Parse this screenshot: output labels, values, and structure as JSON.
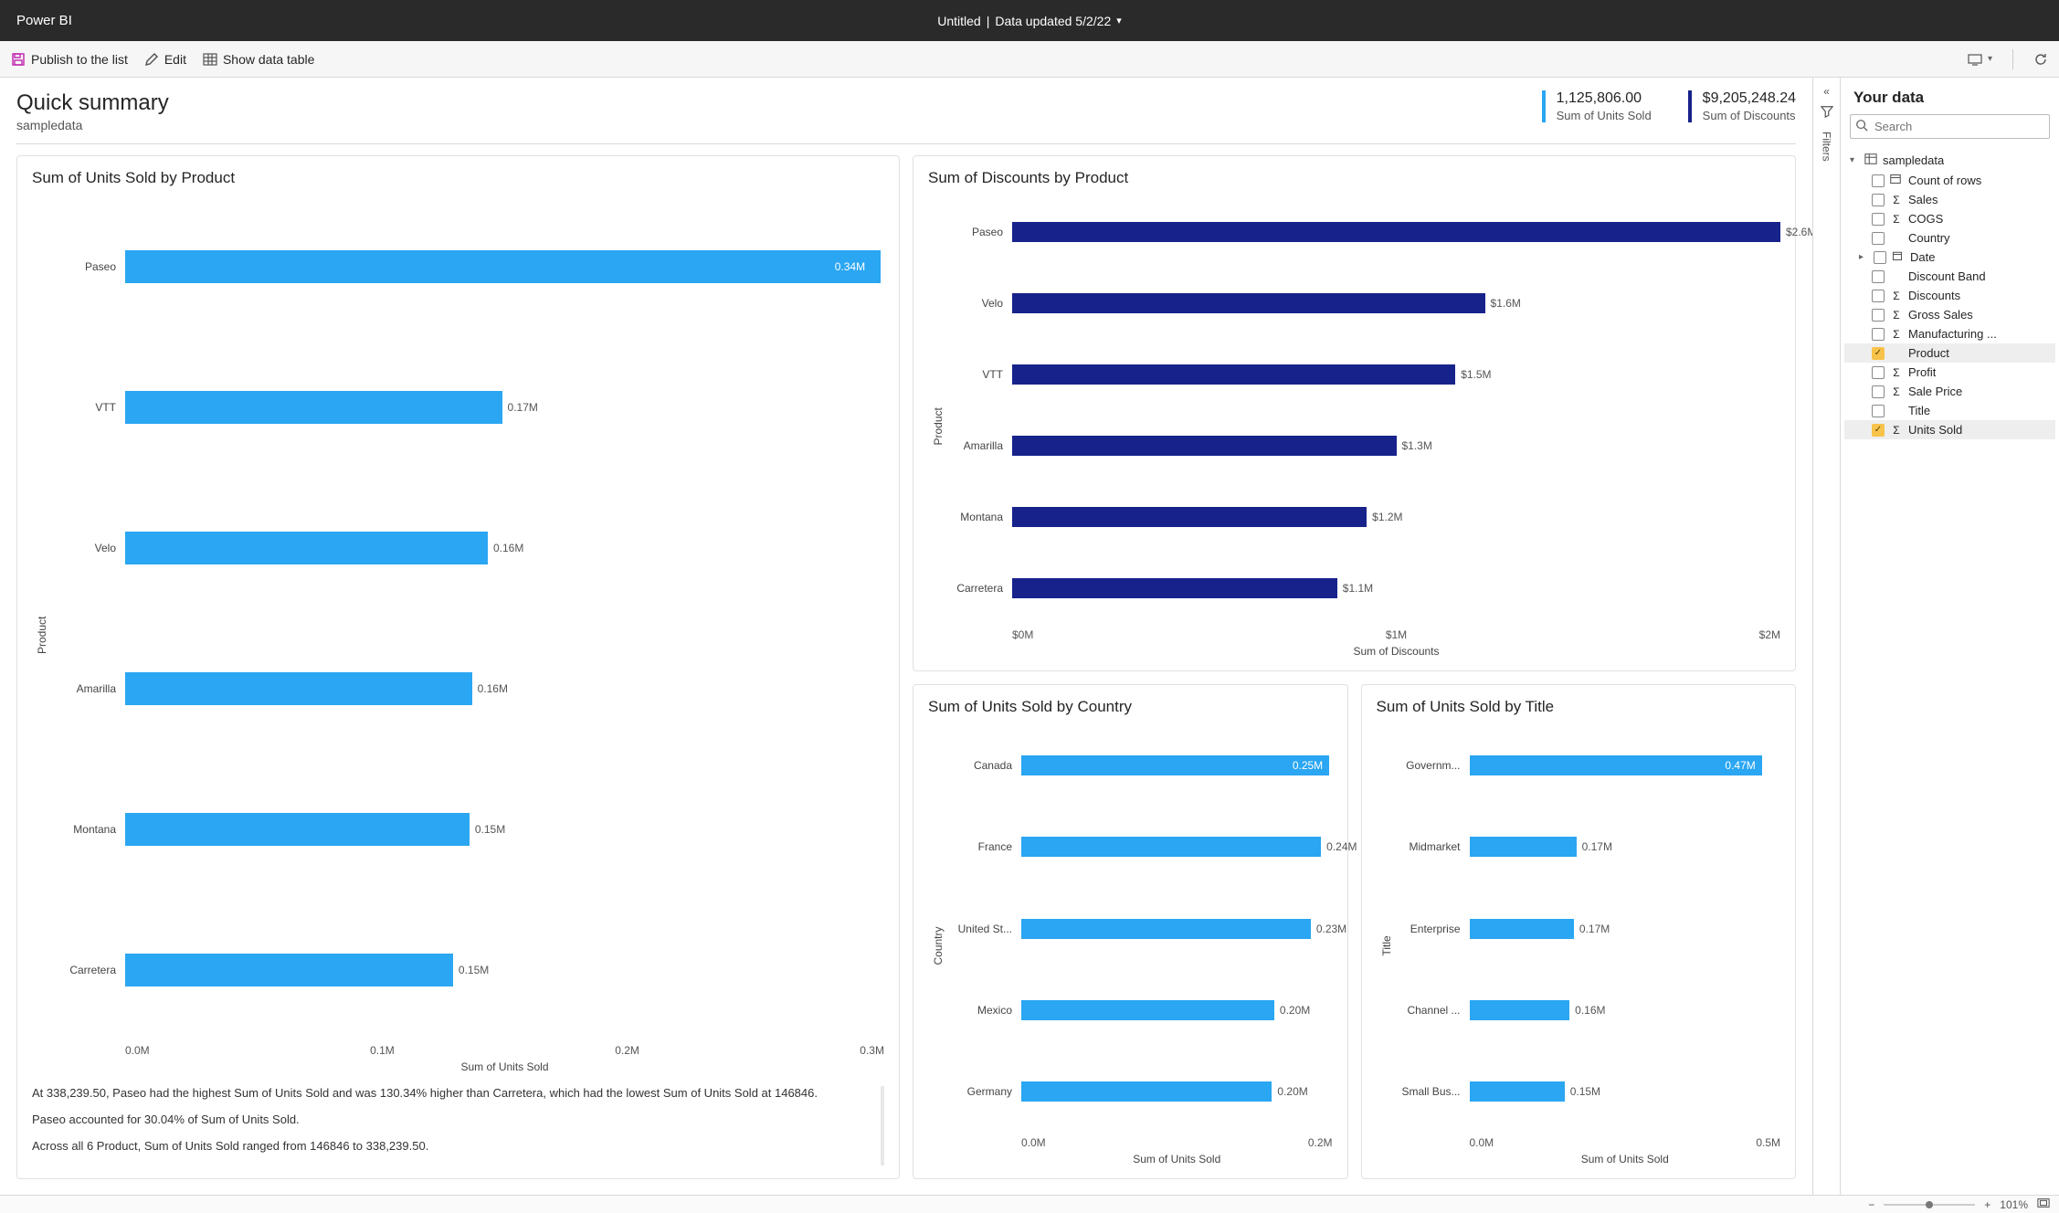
{
  "topbar": {
    "app": "Power BI",
    "doc": "Untitled",
    "updated": "Data updated 5/2/22"
  },
  "toolbar": {
    "publish": "Publish to the list",
    "edit": "Edit",
    "show_table": "Show data table"
  },
  "page": {
    "title": "Quick summary",
    "subtitle": "sampledata"
  },
  "kpi": [
    {
      "value": "1,125,806.00",
      "label": "Sum of Units Sold",
      "style": "cyan"
    },
    {
      "value": "$9,205,248.24",
      "label": "Sum of Discounts",
      "style": "navy"
    }
  ],
  "insights": [
    "At 338,239.50, Paseo had the highest Sum of Units Sold and was 130.34% higher than Carretera, which had the lowest Sum of Units Sold at 146846.",
    "Paseo accounted for 30.04% of Sum of Units Sold.",
    "Across all 6 Product, Sum of Units Sold ranged from 146846 to 338,239.50."
  ],
  "chart_data": [
    {
      "id": "units_by_product",
      "type": "bar",
      "orientation": "horizontal",
      "title": "Sum of Units Sold by Product",
      "xlabel": "Sum of Units Sold",
      "ylabel": "Product",
      "xticks": [
        "0.0M",
        "0.1M",
        "0.2M",
        "0.3M"
      ],
      "xlim": [
        0,
        340000
      ],
      "categories": [
        "Paseo",
        "VTT",
        "Velo",
        "Amarilla",
        "Montana",
        "Carretera"
      ],
      "values": [
        338240,
        168783,
        162425,
        155315,
        154198,
        146846
      ],
      "data_labels": [
        "0.34M",
        "0.17M",
        "0.16M",
        "0.16M",
        "0.15M",
        "0.15M"
      ],
      "label_inside": [
        true,
        false,
        false,
        false,
        false,
        false
      ],
      "color": "cyan"
    },
    {
      "id": "discounts_by_product",
      "type": "bar",
      "orientation": "horizontal",
      "title": "Sum of Discounts by Product",
      "xlabel": "Sum of Discounts",
      "ylabel": "Product",
      "xticks": [
        "$0M",
        "$1M",
        "$2M"
      ],
      "xlim": [
        0,
        2600000
      ],
      "categories": [
        "Paseo",
        "Velo",
        "VTT",
        "Amarilla",
        "Montana",
        "Carretera"
      ],
      "values": [
        2600000,
        1600000,
        1500000,
        1300000,
        1200000,
        1100000
      ],
      "data_labels": [
        "$2.6M",
        "$1.6M",
        "$1.5M",
        "$1.3M",
        "$1.2M",
        "$1.1M"
      ],
      "label_inside": [
        false,
        false,
        false,
        false,
        false,
        false
      ],
      "color": "navy"
    },
    {
      "id": "units_by_country",
      "type": "bar",
      "orientation": "horizontal",
      "title": "Sum of Units Sold by Country",
      "xlabel": "Sum of Units Sold",
      "ylabel": "Country",
      "xticks": [
        "0.0M",
        "0.2M"
      ],
      "xlim": [
        0,
        250000
      ],
      "categories": [
        "Canada",
        "France",
        "United St...",
        "Mexico",
        "Germany"
      ],
      "values": [
        247428,
        240932,
        232628,
        203325,
        201492
      ],
      "data_labels": [
        "0.25M",
        "0.24M",
        "0.23M",
        "0.20M",
        "0.20M"
      ],
      "label_inside": [
        true,
        false,
        false,
        false,
        false
      ],
      "color": "cyan"
    },
    {
      "id": "units_by_title",
      "type": "bar",
      "orientation": "horizontal",
      "title": "Sum of Units Sold by Title",
      "xlabel": "Sum of Units Sold",
      "ylabel": "Title",
      "xticks": [
        "0.0M",
        "0.5M"
      ],
      "xlim": [
        0,
        500000
      ],
      "categories": [
        "Governm...",
        "Midmarket",
        "Enterprise",
        "Channel ...",
        "Small Bus..."
      ],
      "values": [
        470000,
        172000,
        168000,
        161000,
        153000
      ],
      "data_labels": [
        "0.47M",
        "0.17M",
        "0.17M",
        "0.16M",
        "0.15M"
      ],
      "label_inside": [
        true,
        false,
        false,
        false,
        false
      ],
      "color": "cyan"
    }
  ],
  "filters_label": "Filters",
  "right": {
    "title": "Your data",
    "search_placeholder": "Search",
    "table_name": "sampledata",
    "fields": [
      {
        "label": "Count of rows",
        "checked": false,
        "icon": "table"
      },
      {
        "label": "Sales",
        "checked": false,
        "icon": "sigma"
      },
      {
        "label": "COGS",
        "checked": false,
        "icon": "sigma"
      },
      {
        "label": "Country",
        "checked": false,
        "icon": "none"
      },
      {
        "label": "Date",
        "checked": false,
        "icon": "date",
        "expandable": true
      },
      {
        "label": "Discount Band",
        "checked": false,
        "icon": "none"
      },
      {
        "label": "Discounts",
        "checked": false,
        "icon": "sigma"
      },
      {
        "label": "Gross Sales",
        "checked": false,
        "icon": "sigma"
      },
      {
        "label": "Manufacturing ...",
        "checked": false,
        "icon": "sigma"
      },
      {
        "label": "Product",
        "checked": true,
        "icon": "none"
      },
      {
        "label": "Profit",
        "checked": false,
        "icon": "sigma"
      },
      {
        "label": "Sale Price",
        "checked": false,
        "icon": "sigma"
      },
      {
        "label": "Title",
        "checked": false,
        "icon": "none"
      },
      {
        "label": "Units Sold",
        "checked": true,
        "icon": "sigma"
      }
    ]
  },
  "status": {
    "zoom": "101%"
  }
}
